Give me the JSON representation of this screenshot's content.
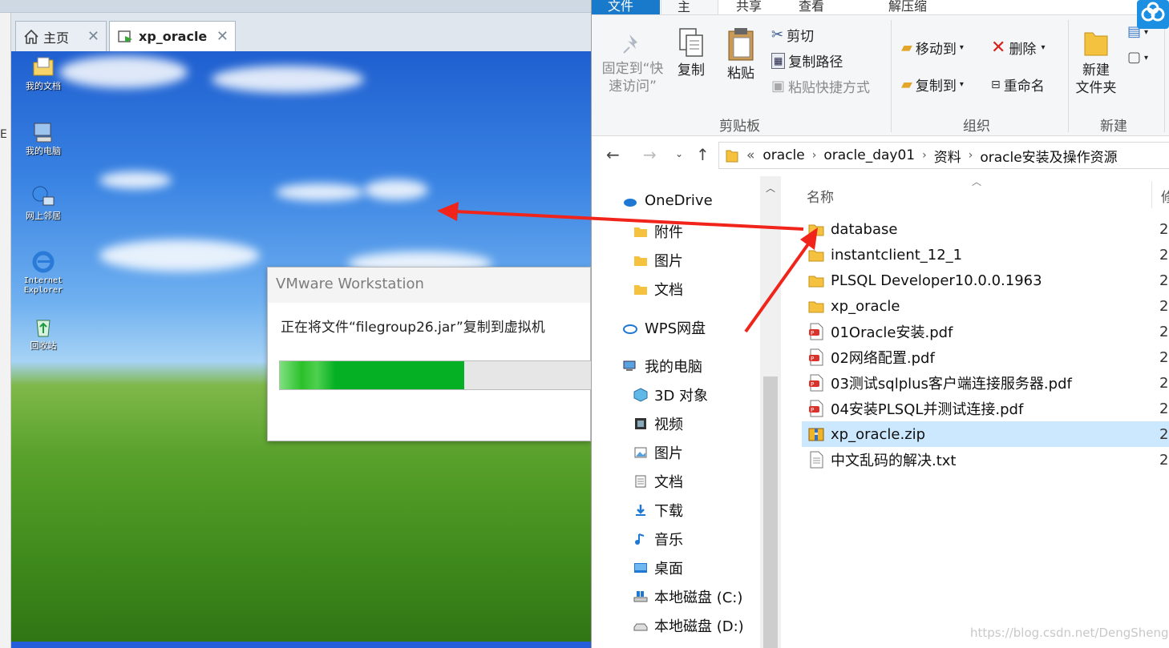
{
  "vmware": {
    "tabs": [
      {
        "label": "主页",
        "icon": "home-icon"
      },
      {
        "label": "xp_oracle",
        "icon": "vm-icon"
      }
    ],
    "desktop_icons": [
      {
        "label": "我的文档",
        "icon": "my-documents-icon"
      },
      {
        "label": "我的电脑",
        "icon": "my-computer-icon"
      },
      {
        "label": "网上邻居",
        "icon": "network-places-icon"
      },
      {
        "label": "Internet Explorer",
        "icon": "internet-explorer-icon"
      },
      {
        "label": "回收站",
        "icon": "recycle-bin-icon"
      }
    ],
    "left_strip_char": "E",
    "dialog": {
      "title": "VMware Workstation",
      "message": "正在将文件“filegroup26.jar”复制到虚拟机",
      "progress": 0.59
    }
  },
  "explorer": {
    "ribbon_tabs": [
      "文件",
      "主页",
      "共享",
      "查看",
      "解压缩"
    ],
    "clipboard": {
      "pin": "固定到“快\n速访问”",
      "copy": "复制",
      "paste": "粘贴",
      "cut": "剪切",
      "copy_path": "复制路径",
      "paste_shortcut": "粘贴快捷方式",
      "group_label": "剪贴板"
    },
    "organize": {
      "move_to": "移动到",
      "copy_to": "复制到",
      "delete": "删除",
      "rename": "重命名",
      "group_label": "组织"
    },
    "new": {
      "new_folder": "新建\n文件夹",
      "group_label": "新建"
    },
    "address": {
      "prefix": "«",
      "crumbs": [
        "oracle",
        "oracle_day01",
        "资料",
        "oracle安装及操作资源"
      ]
    },
    "nav": [
      {
        "label": "OneDrive",
        "icon": "onedrive-icon"
      },
      {
        "label": "附件",
        "icon": "folder-pin-icon"
      },
      {
        "label": "图片",
        "icon": "folder-pin-icon"
      },
      {
        "label": "文档",
        "icon": "folder-pin-icon"
      },
      {
        "label": "WPS网盘",
        "icon": "wps-cloud-icon"
      },
      {
        "label": "我的电脑",
        "icon": "computer-icon"
      },
      {
        "label": "3D 对象",
        "icon": "3d-objects-icon"
      },
      {
        "label": "视频",
        "icon": "videos-icon"
      },
      {
        "label": "图片",
        "icon": "pictures-icon"
      },
      {
        "label": "文档",
        "icon": "documents-icon"
      },
      {
        "label": "下载",
        "icon": "downloads-icon"
      },
      {
        "label": "音乐",
        "icon": "music-icon"
      },
      {
        "label": "桌面",
        "icon": "desktop-icon"
      },
      {
        "label": "本地磁盘 (C:)",
        "icon": "drive-c-icon"
      },
      {
        "label": "本地磁盘 (D:)",
        "icon": "drive-d-icon"
      }
    ],
    "columns": {
      "name": "名称",
      "modified": "修"
    },
    "files": [
      {
        "name": "database",
        "type": "folder",
        "date": "2"
      },
      {
        "name": "instantclient_12_1",
        "type": "folder",
        "date": "2"
      },
      {
        "name": "PLSQL Developer10.0.0.1963",
        "type": "folder",
        "date": "2"
      },
      {
        "name": "xp_oracle",
        "type": "folder",
        "date": "2"
      },
      {
        "name": "01Oracle安装.pdf",
        "type": "pdf",
        "date": "2"
      },
      {
        "name": "02网络配置.pdf",
        "type": "pdf",
        "date": "2"
      },
      {
        "name": "03测试sqlplus客户端连接服务器.pdf",
        "type": "pdf",
        "date": "2"
      },
      {
        "name": "04安装PLSQL并测试连接.pdf",
        "type": "pdf",
        "date": "2"
      },
      {
        "name": "xp_oracle.zip",
        "type": "zip",
        "date": "2",
        "selected": true
      },
      {
        "name": "中文乱码的解决.txt",
        "type": "txt",
        "date": "2"
      }
    ]
  },
  "watermark": "https://blog.csdn.net/DengShengL",
  "colors": {
    "arrow": "#f0241a",
    "selection": "#cce8ff",
    "progress": "#06b025",
    "file_tab": "#1979ca",
    "folder": "#f4c23e"
  }
}
